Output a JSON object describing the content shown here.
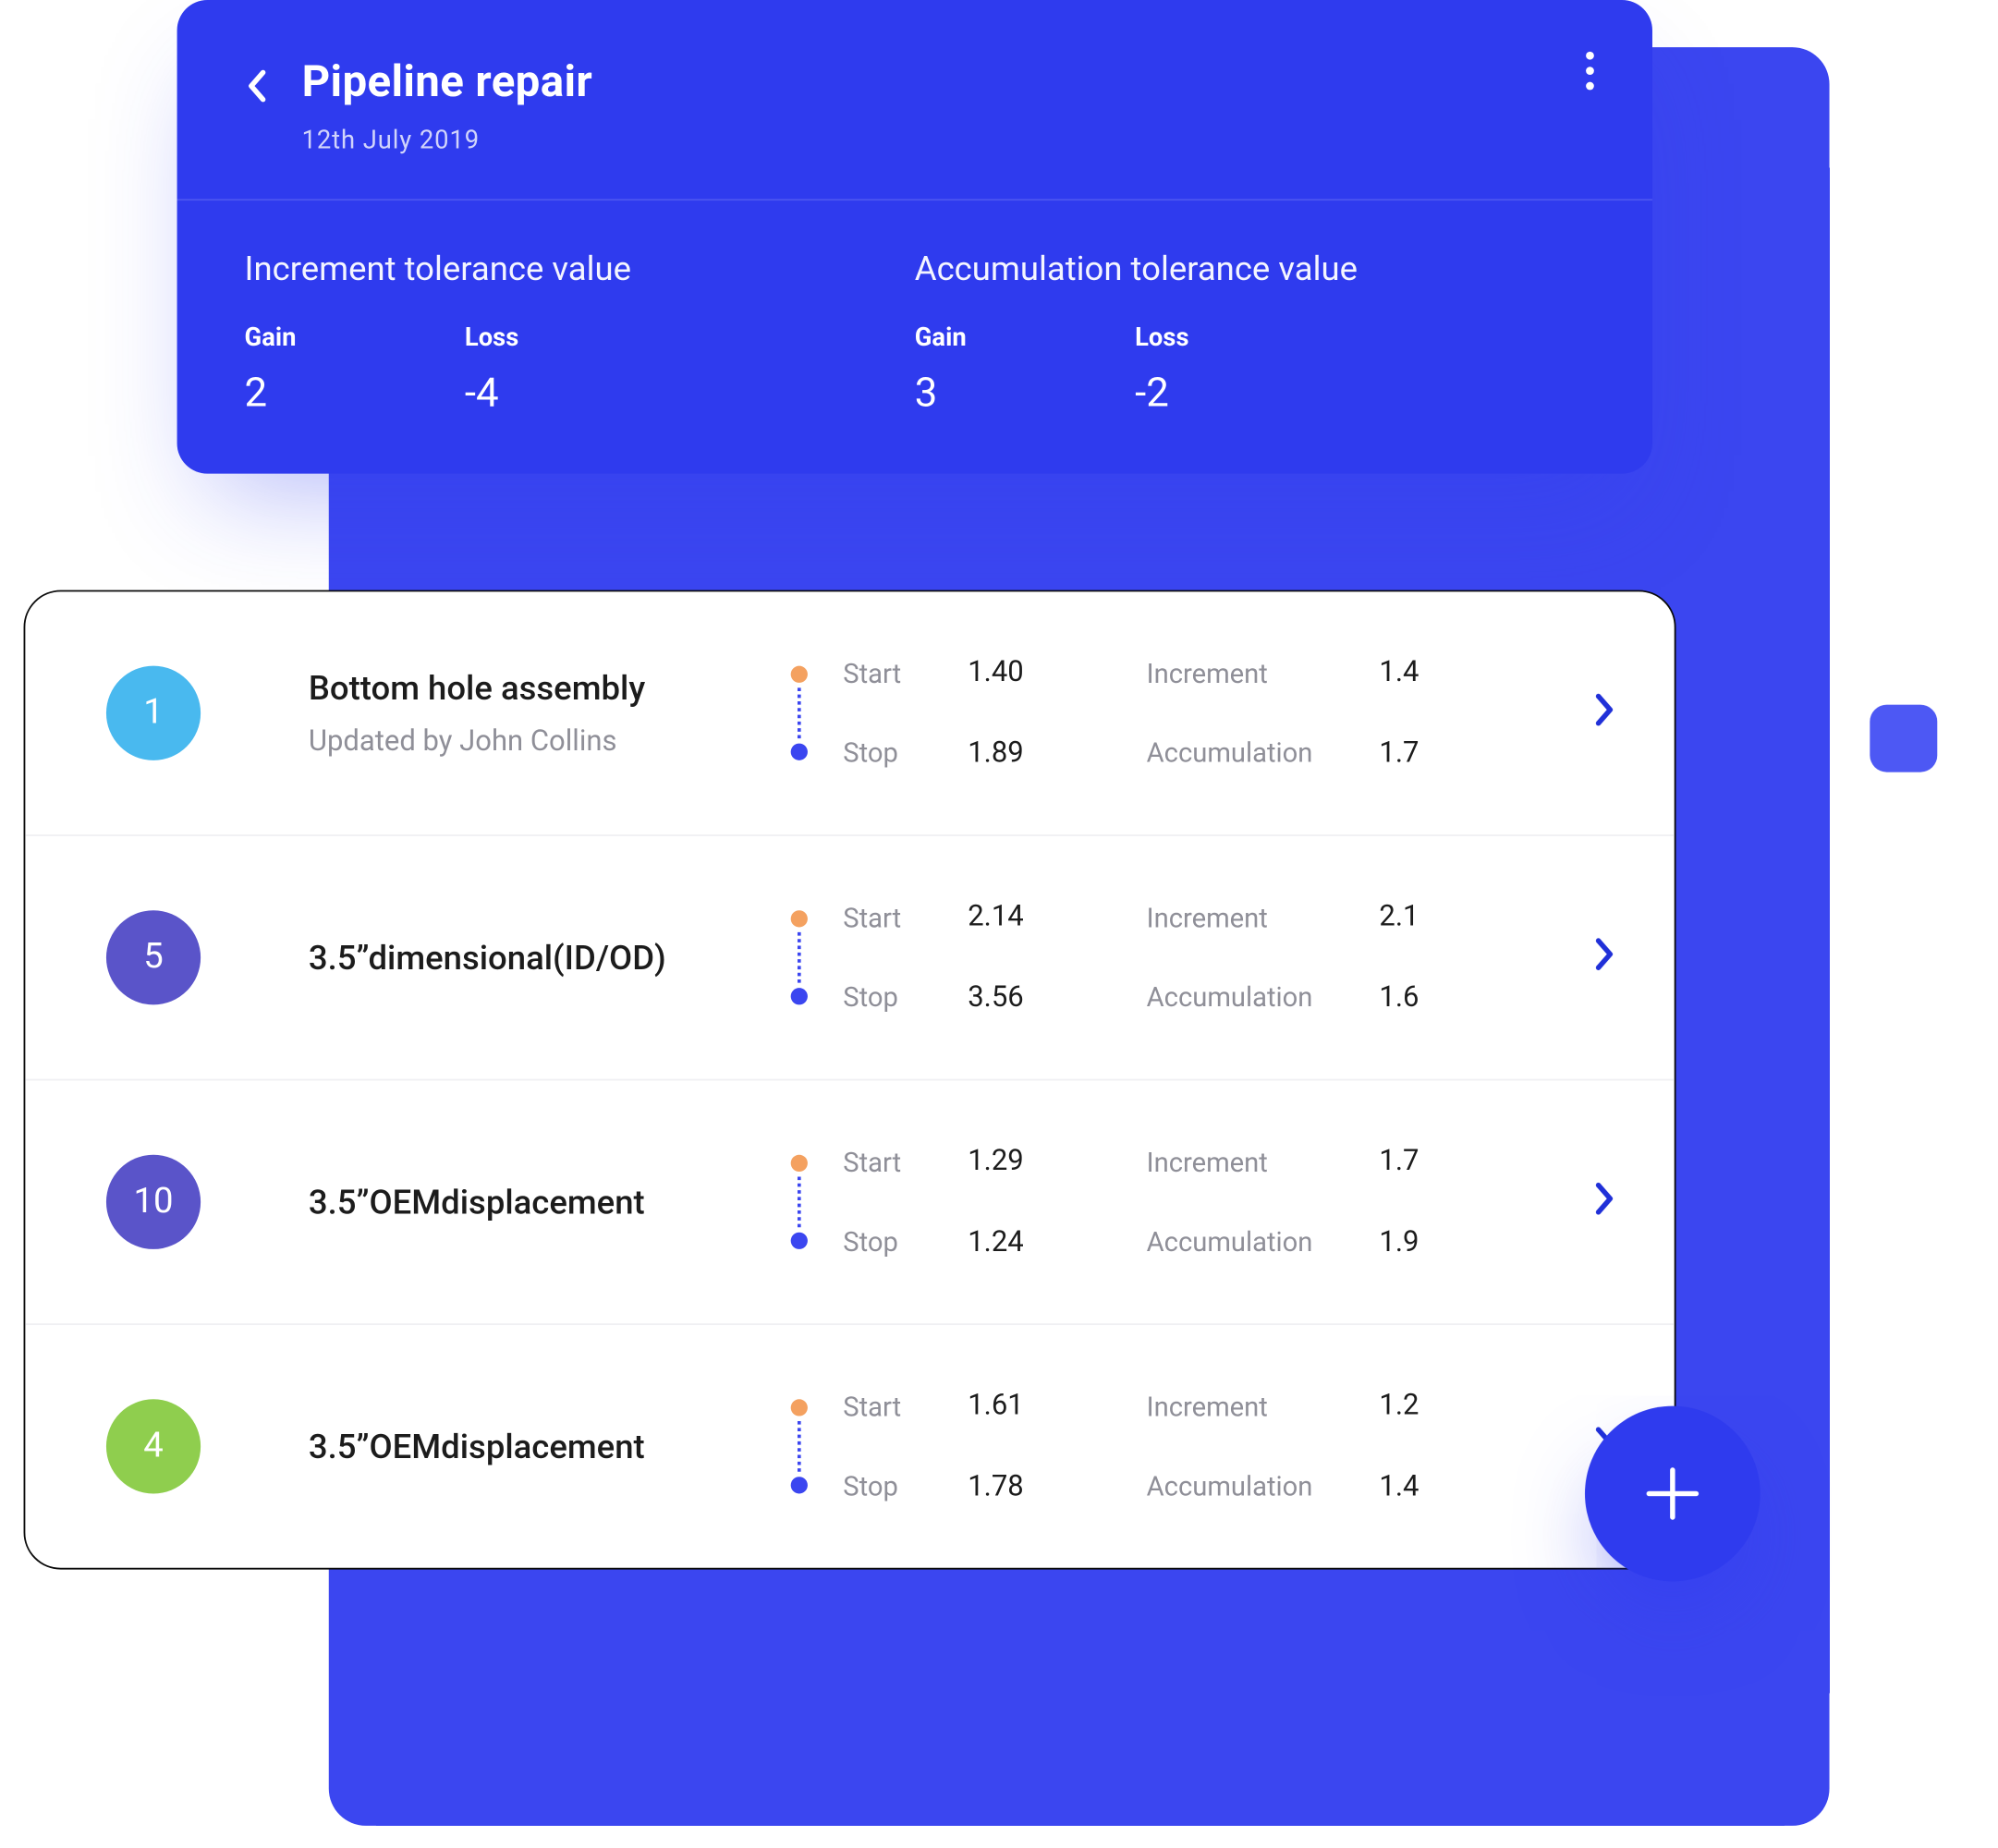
{
  "colors": {
    "primary": "#2f3bee",
    "bgPanel": "#3b46f0",
    "start": "#f4a160",
    "stop": "#3b46f0",
    "badgeBlue": "#49b9ef",
    "badgePurple": "#5a54c9",
    "badgeGreen": "#8fce4e"
  },
  "header": {
    "title": "Pipeline repair",
    "date": "12th July 2019",
    "increment": {
      "title": "Increment tolerance value",
      "gain_label": "Gain",
      "gain_value": "2",
      "loss_label": "Loss",
      "loss_value": "-4"
    },
    "accumulation": {
      "title": "Accumulation tolerance value",
      "gain_label": "Gain",
      "gain_value": "3",
      "loss_label": "Loss",
      "loss_value": "-2"
    }
  },
  "labels": {
    "start": "Start",
    "stop": "Stop",
    "increment": "Increment",
    "accumulation": "Accumulation"
  },
  "rows": [
    {
      "badge": "1",
      "badge_color": "badgeBlue",
      "title": "Bottom hole assembly",
      "subtitle": "Updated by John Collins",
      "start": "1.40",
      "stop": "1.89",
      "increment": "1.4",
      "accumulation": "1.7"
    },
    {
      "badge": "5",
      "badge_color": "badgePurple",
      "title": "3.5”dimensional(ID/OD)",
      "subtitle": "",
      "start": "2.14",
      "stop": "3.56",
      "increment": "2.1",
      "accumulation": "1.6"
    },
    {
      "badge": "10",
      "badge_color": "badgePurple",
      "title": "3.5”OEMdisplacement",
      "subtitle": "",
      "start": "1.29",
      "stop": "1.24",
      "increment": "1.7",
      "accumulation": "1.9"
    },
    {
      "badge": "4",
      "badge_color": "badgeGreen",
      "title": "3.5”OEMdisplacement",
      "subtitle": "",
      "start": "1.61",
      "stop": "1.78",
      "increment": "1.2",
      "accumulation": "1.4"
    }
  ]
}
